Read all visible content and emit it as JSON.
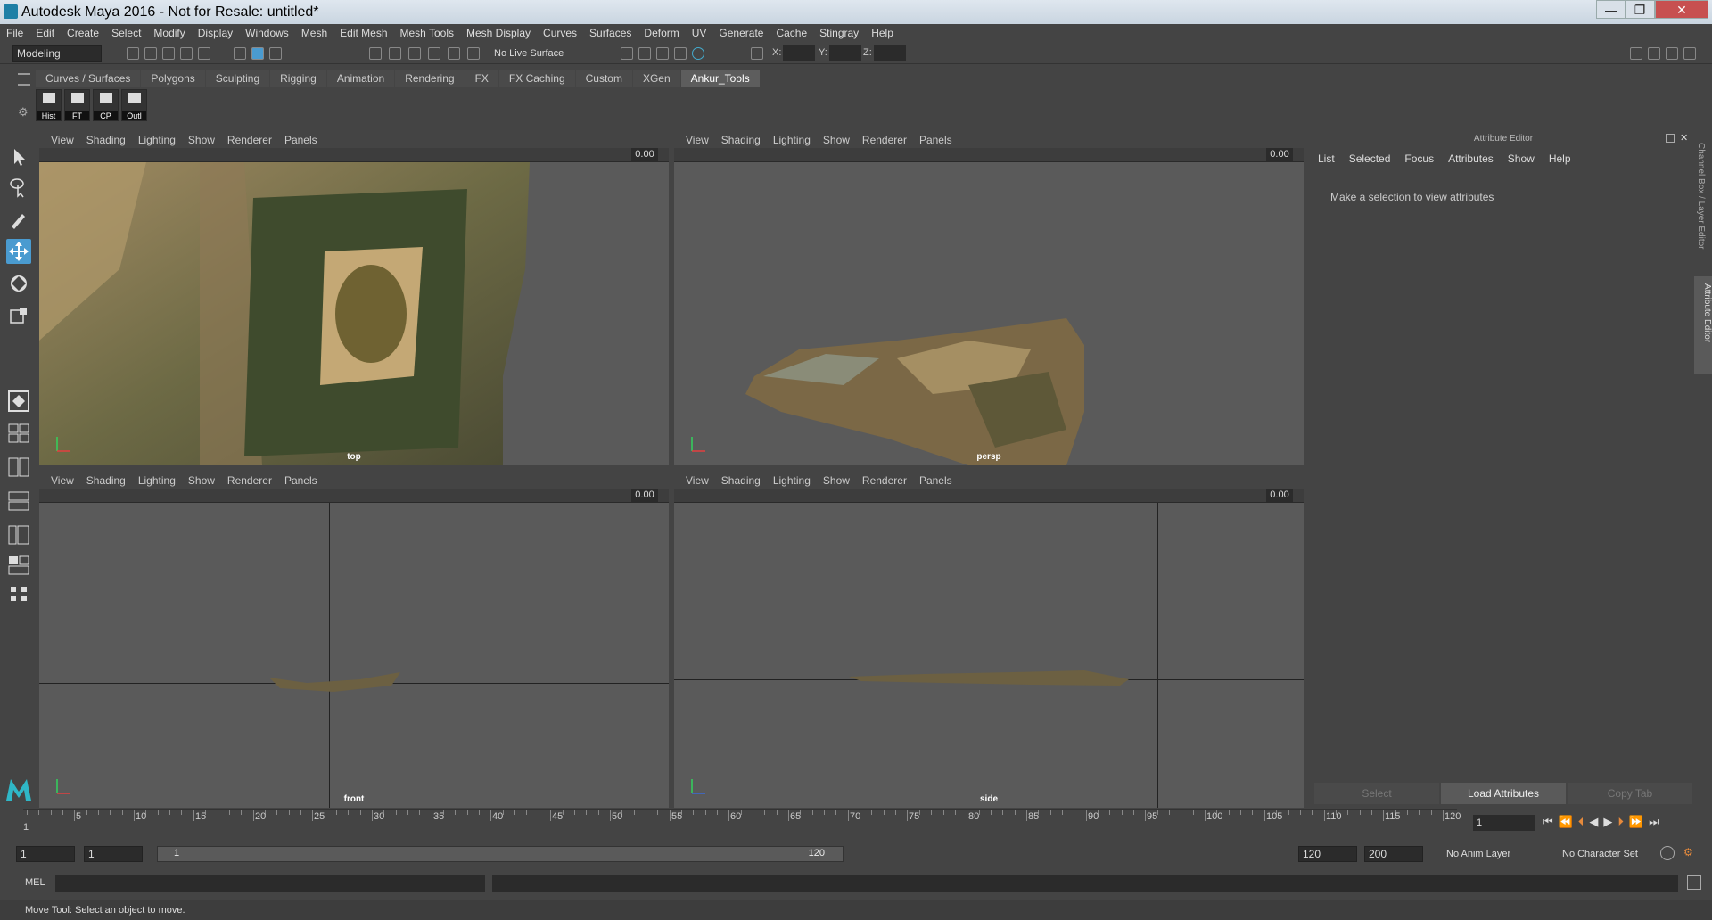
{
  "window": {
    "title": "Autodesk Maya 2016 - Not for Resale: untitled*",
    "minimize": "—",
    "maximize": "❐",
    "close": "✕"
  },
  "menubar": [
    "File",
    "Edit",
    "Create",
    "Select",
    "Modify",
    "Display",
    "Windows",
    "Mesh",
    "Edit Mesh",
    "Mesh Tools",
    "Mesh Display",
    "Curves",
    "Surfaces",
    "Deform",
    "UV",
    "Generate",
    "Cache",
    "Stingray",
    "Help"
  ],
  "status": {
    "mode": "Modeling",
    "live_surface": "No Live Surface",
    "x_label": "X:",
    "y_label": "Y:",
    "z_label": "Z:"
  },
  "shelf": {
    "tabs": [
      "Curves / Surfaces",
      "Polygons",
      "Sculpting",
      "Rigging",
      "Animation",
      "Rendering",
      "FX",
      "FX Caching",
      "Custom",
      "XGen",
      "Ankur_Tools"
    ],
    "active": "Ankur_Tools",
    "buttons": [
      "Hist",
      "FT",
      "CP",
      "Outl"
    ]
  },
  "panel_menu": [
    "View",
    "Shading",
    "Lighting",
    "Show",
    "Renderer",
    "Panels"
  ],
  "viewports": [
    {
      "label": "top",
      "value": "0.00"
    },
    {
      "label": "persp",
      "value": "0.00"
    },
    {
      "label": "front",
      "value": "0.00"
    },
    {
      "label": "side",
      "value": "0.00"
    }
  ],
  "attribute_editor": {
    "title": "Attribute Editor",
    "menu": [
      "List",
      "Selected",
      "Focus",
      "Attributes",
      "Show",
      "Help"
    ],
    "message": "Make a selection to view attributes",
    "buttons": [
      "Select",
      "Load Attributes",
      "Copy Tab"
    ]
  },
  "side_tabs": [
    "Channel Box / Layer Editor",
    "Attribute Editor"
  ],
  "timeline": {
    "ticks": [
      "5",
      "10",
      "15",
      "20",
      "25",
      "30",
      "35",
      "40",
      "45",
      "50",
      "55",
      "60",
      "65",
      "70",
      "75",
      "80",
      "85",
      "90",
      "95",
      "100",
      "105",
      "110",
      "115",
      "120"
    ],
    "start": "1",
    "current": "1"
  },
  "range": {
    "start": "1",
    "start2": "1",
    "slider_start": "1",
    "slider_end": "120",
    "end": "120",
    "end2": "200",
    "anim_layer": "No Anim Layer",
    "char_set": "No Character Set"
  },
  "cmd": {
    "lang": "MEL"
  },
  "help": "Move Tool: Select an object to move."
}
